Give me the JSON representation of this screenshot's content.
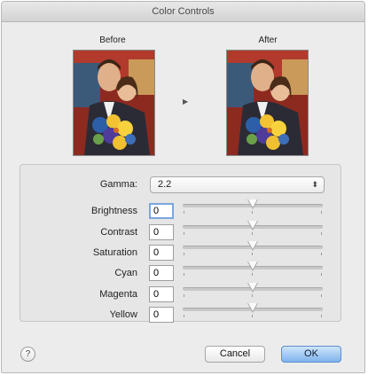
{
  "window": {
    "title": "Color Controls"
  },
  "preview": {
    "before_label": "Before",
    "after_label": "After",
    "arrow_glyph": "▶"
  },
  "gamma": {
    "label": "Gamma:",
    "value": "2.2",
    "chevron": "⬍"
  },
  "controls": [
    {
      "label": "Brightness",
      "value": "0",
      "level": 0.5
    },
    {
      "label": "Contrast",
      "value": "0",
      "level": 0.5
    },
    {
      "label": "Saturation",
      "value": "0",
      "level": 0.5
    },
    {
      "label": "Cyan",
      "value": "0",
      "level": 0.5
    },
    {
      "label": "Magenta",
      "value": "0",
      "level": 0.5
    },
    {
      "label": "Yellow",
      "value": "0",
      "level": 0.5
    }
  ],
  "footer": {
    "help_label": "?",
    "cancel_label": "Cancel",
    "ok_label": "OK"
  },
  "colors": {
    "default_button": "#7fb3ec",
    "focus_ring": "#7aa7df",
    "window_bg": "#ececec"
  }
}
